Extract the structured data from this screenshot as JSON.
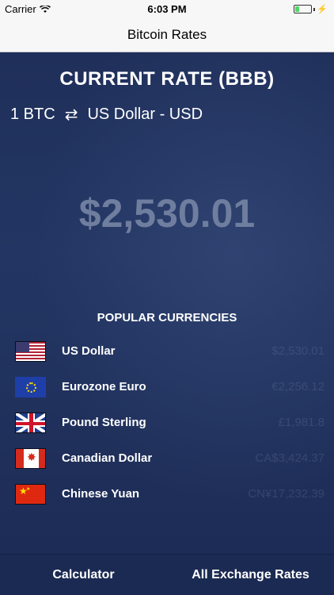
{
  "status_bar": {
    "carrier": "Carrier",
    "time": "6:03 PM",
    "battery_level": 0.25
  },
  "nav": {
    "title": "Bitcoin Rates"
  },
  "header": {
    "title": "CURRENT RATE (BBB)",
    "base": "1 BTC",
    "swap_symbol": "⇄",
    "target": "US Dollar - USD",
    "rate": "$2,530.01"
  },
  "popular": {
    "title": "POPULAR CURRENCIES",
    "items": [
      {
        "name": "US Dollar",
        "value": "$2,530.01",
        "flag": "us-flag"
      },
      {
        "name": "Eurozone Euro",
        "value": "€2,256.12",
        "flag": "eu-flag"
      },
      {
        "name": "Pound Sterling",
        "value": "£1,981.8",
        "flag": "uk-flag"
      },
      {
        "name": "Canadian Dollar",
        "value": "CA$3,424.37",
        "flag": "ca-flag"
      },
      {
        "name": "Chinese Yuan",
        "value": "CN¥17,232.39",
        "flag": "cn-flag"
      }
    ]
  },
  "tabs": {
    "calculator": "Calculator",
    "all_rates": "All Exchange Rates"
  },
  "colors": {
    "background": "#1c2c55",
    "rate_text": "#6f7e9e",
    "tab_bar": "#1b2a52"
  }
}
